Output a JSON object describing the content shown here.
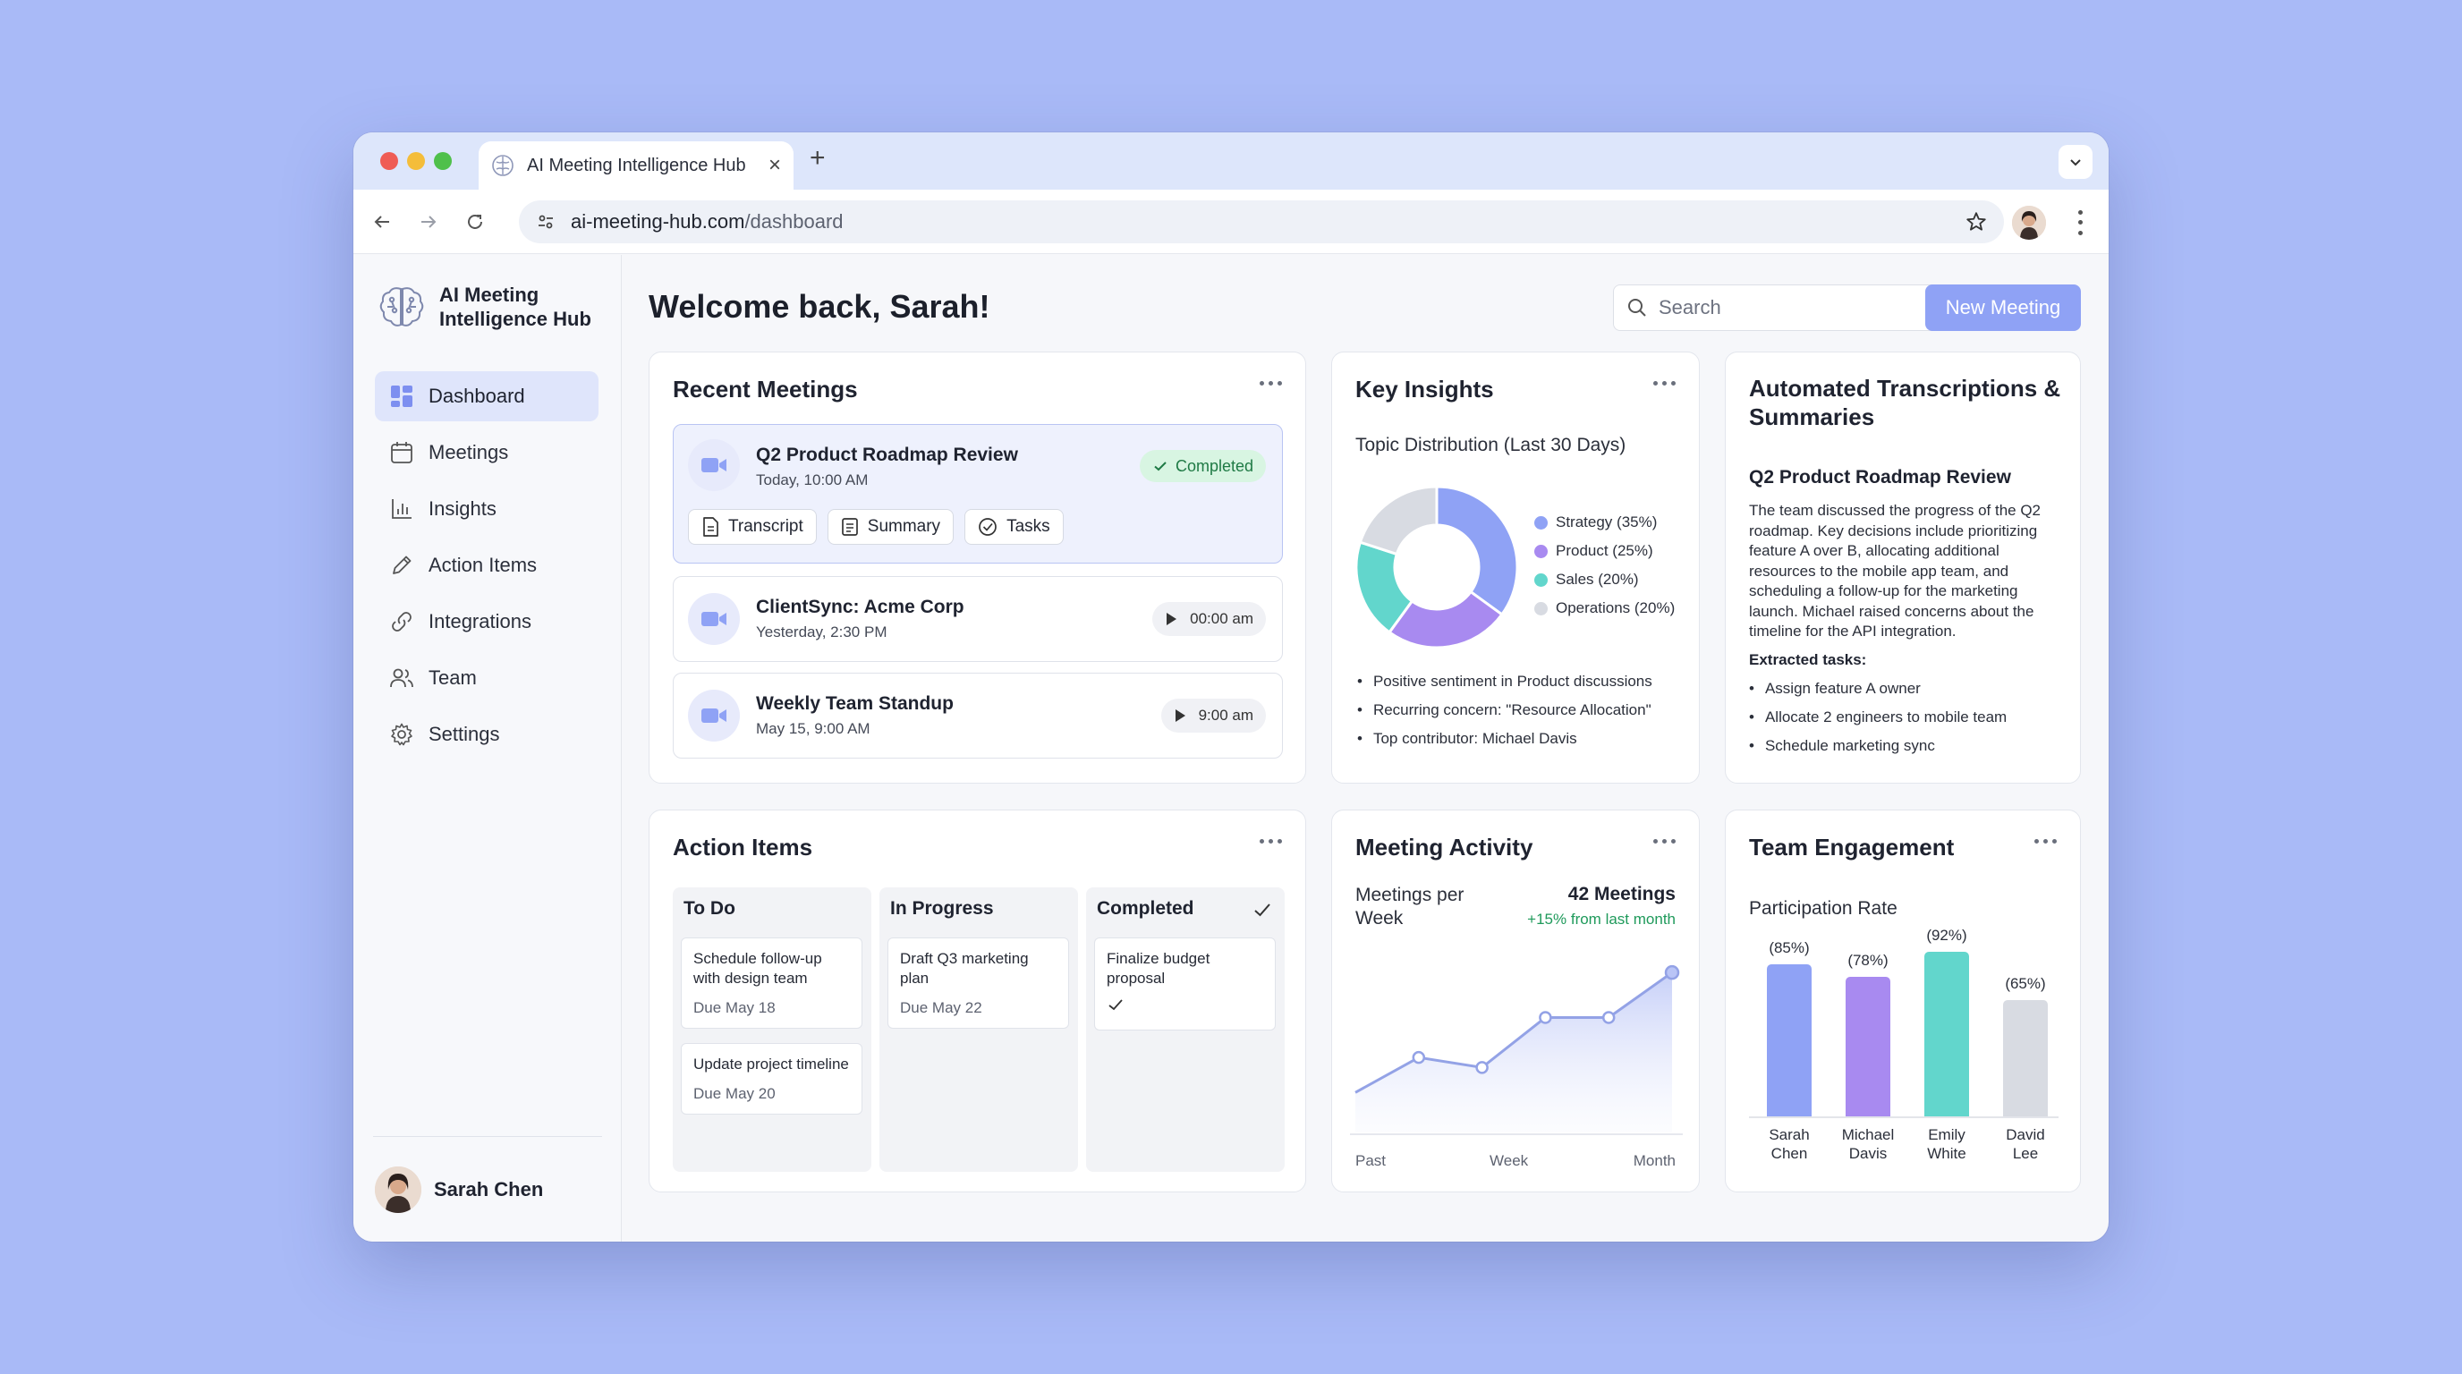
{
  "browser": {
    "tab_title": "AI Meeting Intelligence Hub",
    "url_domain": "ai-meeting-hub.com",
    "url_path": "/dashboard"
  },
  "sidebar": {
    "brand": "AI Meeting Intelligence Hub",
    "items": [
      {
        "label": "Dashboard",
        "icon": "dashboard-icon",
        "active": true
      },
      {
        "label": "Meetings",
        "icon": "calendar-icon",
        "active": false
      },
      {
        "label": "Insights",
        "icon": "bar-chart-icon",
        "active": false
      },
      {
        "label": "Action Items",
        "icon": "pencil-icon",
        "active": false
      },
      {
        "label": "Integrations",
        "icon": "link-icon",
        "active": false
      },
      {
        "label": "Team",
        "icon": "users-icon",
        "active": false
      },
      {
        "label": "Settings",
        "icon": "gear-icon",
        "active": false
      }
    ],
    "user_name": "Sarah Chen"
  },
  "header": {
    "title": "Welcome back, Sarah!",
    "search_placeholder": "Search",
    "new_meeting_label": "New Meeting"
  },
  "recent_meetings": {
    "title": "Recent Meetings",
    "items": [
      {
        "name": "Q2 Product Roadmap Review",
        "time": "Today, 10:00 AM",
        "status": "Completed",
        "actions": [
          "Transcript",
          "Summary",
          "Tasks"
        ]
      },
      {
        "name": "ClientSync: Acme Corp",
        "time": "Yesterday, 2:30 PM",
        "play_label": "00:00 am"
      },
      {
        "name": "Weekly Team Standup",
        "time": "May 15, 9:00 AM",
        "play_label": "9:00 am"
      }
    ]
  },
  "key_insights": {
    "title": "Key Insights",
    "subtitle": "Topic Distribution (Last 30 Days)",
    "legend": [
      "Strategy (35%)",
      "Product (25%)",
      "Sales (20%)",
      "Operations (20%)"
    ],
    "bullets": [
      "Positive sentiment in Product discussions",
      "Recurring concern: \"Resource Allocation\"",
      "Top contributor: Michael Davis"
    ]
  },
  "transcriptions": {
    "title": "Automated Transcriptions & Summaries",
    "meeting": "Q2 Product Roadmap Review",
    "summary": "The team discussed the progress of the Q2 roadmap. Key decisions include prioritizing feature A over B, allocating additional resources to the mobile app team, and scheduling a follow-up for the marketing launch. Michael raised concerns about the timeline for the API integration.",
    "tasks_label": "Extracted tasks:",
    "tasks": [
      "Assign feature A owner",
      "Allocate 2 engineers to mobile team",
      "Schedule marketing sync"
    ]
  },
  "action_items": {
    "title": "Action Items",
    "columns": [
      {
        "title": "To Do",
        "cards": [
          {
            "text": "Schedule follow-up with design team",
            "due": "Due May 18"
          },
          {
            "text": "Update project timeline",
            "due": "Due May 20"
          }
        ]
      },
      {
        "title": "In Progress",
        "cards": [
          {
            "text": "Draft Q3 marketing plan",
            "due": "Due May 22"
          }
        ]
      },
      {
        "title": "Completed",
        "cards": [
          {
            "text": "Finalize budget proposal",
            "due": ""
          }
        ]
      }
    ]
  },
  "meeting_activity": {
    "title": "Meeting Activity",
    "label": "Meetings per Week",
    "value": "42 Meetings",
    "delta": "+15% from last month",
    "x_labels": [
      "Past",
      "Week",
      "Month"
    ]
  },
  "team_engagement": {
    "title": "Team Engagement",
    "subtitle": "Participation Rate"
  },
  "colors": {
    "accent": "#8fa2f5",
    "strategy": "#8fa2f5",
    "product": "#a88af0",
    "sales": "#62d6cc",
    "operations": "#d8dbe2",
    "success": "#1f9a5b"
  },
  "chart_data": [
    {
      "type": "pie",
      "categories": [
        "Strategy",
        "Product",
        "Sales",
        "Operations"
      ],
      "values": [
        35,
        25,
        20,
        20
      ],
      "labels": [
        "Strategy (35%)",
        "Product (25%)",
        "Sales (20%)",
        "Operations (20%)"
      ]
    },
    {
      "type": "area",
      "x": [
        1,
        2,
        3,
        4,
        5,
        6
      ],
      "values": [
        18,
        25,
        23,
        33,
        33,
        42
      ],
      "xlabel": "",
      "ylabel": "",
      "ylim": [
        10,
        44
      ],
      "tick_labels": [
        "Past",
        "Week",
        "Month"
      ],
      "grid": false
    },
    {
      "type": "bar",
      "categories": [
        "Sarah Chen",
        "Michael Davis",
        "Emily White",
        "David Lee"
      ],
      "values": [
        85,
        78,
        92,
        65
      ],
      "data_labels": [
        "(85%)",
        "(78%)",
        "(92%)",
        "(65%)"
      ],
      "ylim": [
        0,
        100
      ]
    }
  ]
}
